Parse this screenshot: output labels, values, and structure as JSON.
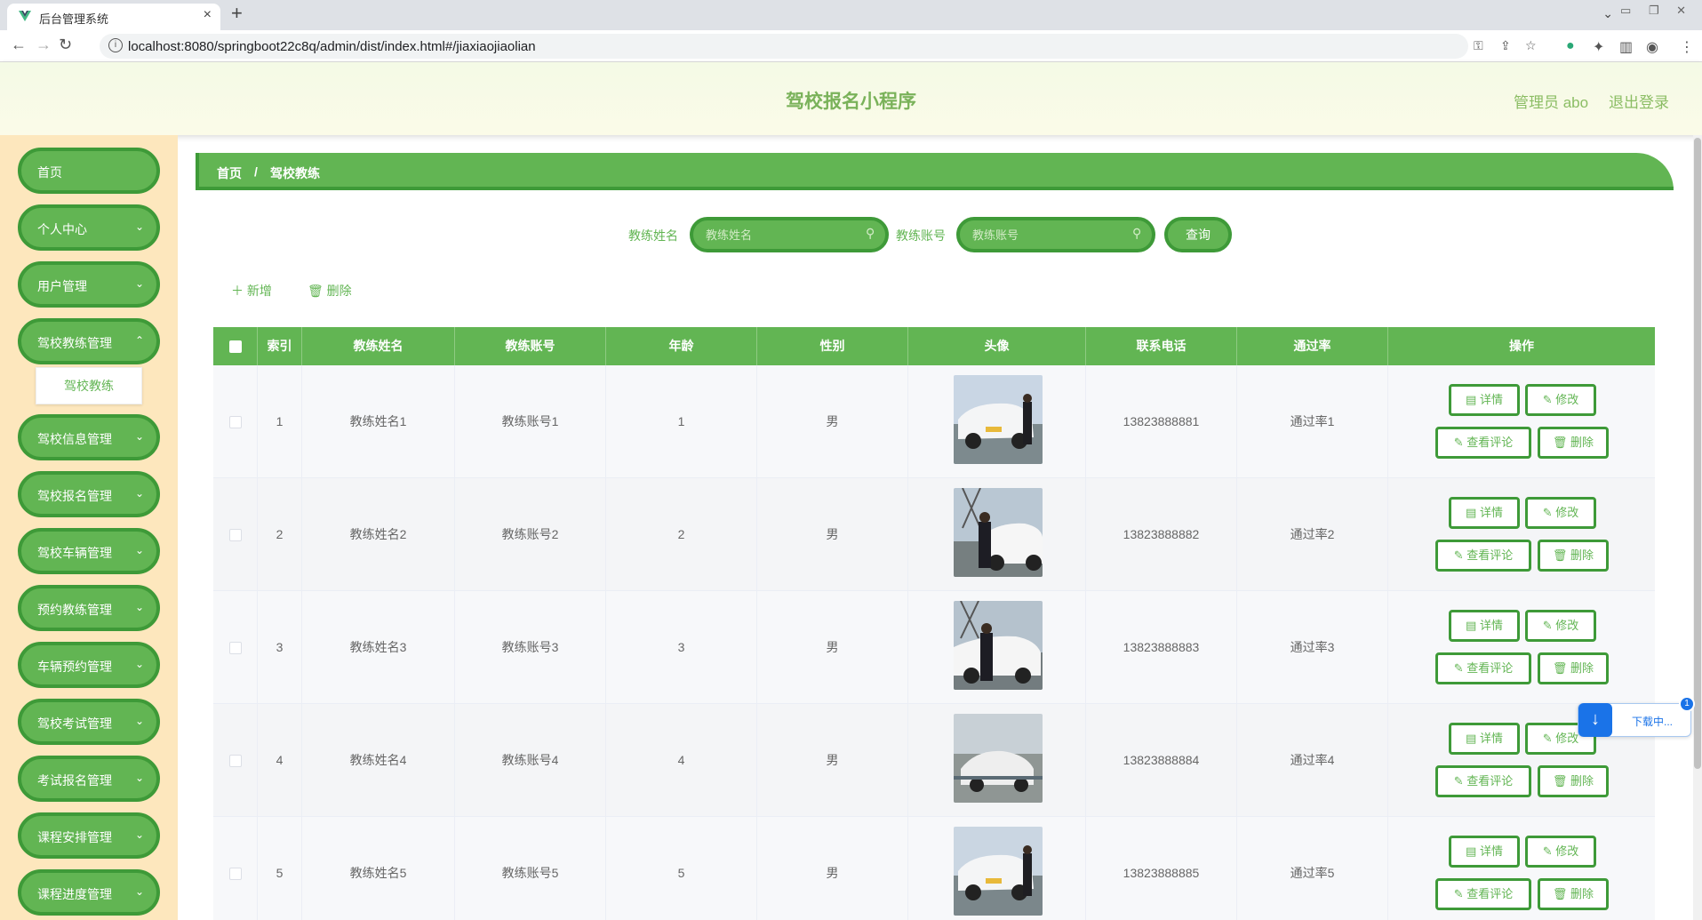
{
  "browser": {
    "tab_title": "后台管理系统",
    "url": "localhost:8080/springboot22c8q/admin/dist/index.html#/jiaxiaojiaolian"
  },
  "header": {
    "app_title": "驾校报名小程序",
    "admin_label": "管理员 abo",
    "logout_label": "退出登录"
  },
  "sidebar": {
    "items": [
      {
        "label": "首页"
      },
      {
        "label": "个人中心"
      },
      {
        "label": "用户管理"
      },
      {
        "label": "驾校教练管理"
      },
      {
        "label": "驾校信息管理"
      },
      {
        "label": "驾校报名管理"
      },
      {
        "label": "驾校车辆管理"
      },
      {
        "label": "预约教练管理"
      },
      {
        "label": "车辆预约管理"
      },
      {
        "label": "驾校考试管理"
      },
      {
        "label": "考试报名管理"
      },
      {
        "label": "课程安排管理"
      },
      {
        "label": "课程进度管理"
      }
    ],
    "submenu_active": "驾校教练"
  },
  "breadcrumb": {
    "home": "首页",
    "separator": "/",
    "current": "驾校教练"
  },
  "search": {
    "name_label": "教练姓名",
    "name_placeholder": "教练姓名",
    "account_label": "教练账号",
    "account_placeholder": "教练账号",
    "query_button": "查询"
  },
  "actions": {
    "add_label": "新增",
    "delete_label": "删除"
  },
  "table": {
    "columns": [
      "索引",
      "教练姓名",
      "教练账号",
      "年龄",
      "性别",
      "头像",
      "联系电话",
      "通过率",
      "操作"
    ],
    "rows": [
      {
        "index": "1",
        "name": "教练姓名1",
        "account": "教练账号1",
        "age": "1",
        "gender": "男",
        "phone": "13823888881",
        "pass_rate": "通过率1"
      },
      {
        "index": "2",
        "name": "教练姓名2",
        "account": "教练账号2",
        "age": "2",
        "gender": "男",
        "phone": "13823888882",
        "pass_rate": "通过率2"
      },
      {
        "index": "3",
        "name": "教练姓名3",
        "account": "教练账号3",
        "age": "3",
        "gender": "男",
        "phone": "13823888883",
        "pass_rate": "通过率3"
      },
      {
        "index": "4",
        "name": "教练姓名4",
        "account": "教练账号4",
        "age": "4",
        "gender": "男",
        "phone": "13823888884",
        "pass_rate": "通过率4"
      },
      {
        "index": "5",
        "name": "教练姓名5",
        "account": "教练账号5",
        "age": "5",
        "gender": "男",
        "phone": "13823888885",
        "pass_rate": "通过率5"
      }
    ],
    "ops": {
      "detail": "详情",
      "edit": "修改",
      "comments": "查看评论",
      "delete": "删除"
    }
  },
  "download": {
    "text": "下载中...",
    "badge": "1"
  },
  "colors": {
    "primary": "#62b553",
    "primary_border": "#3e9a38",
    "sidebar_bg": "#fde7bd",
    "title": "#7ab25a"
  }
}
